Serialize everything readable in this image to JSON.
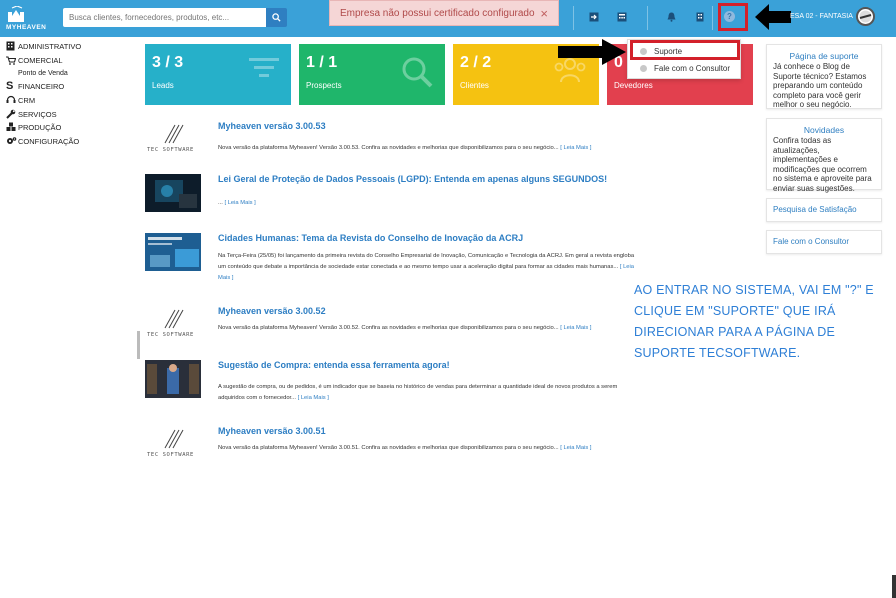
{
  "topbar": {
    "logo_text": "MYHEAVEN",
    "search_placeholder": "Busca clientes, fornecedores, produtos, etc...",
    "toast_message": "Empresa não possui certificado configurado",
    "toast_close": "×",
    "help_glyph": "?",
    "company_label": "ESA 02 - FANTASIA",
    "bg_color": "#3aa1d8"
  },
  "sidebar": {
    "items": [
      {
        "label": "ADMINISTRATIVO",
        "icon": "building-icon"
      },
      {
        "label": "COMERCIAL",
        "icon": "cart-icon"
      },
      {
        "label": "Ponto de Venda",
        "icon": "pos-icon"
      },
      {
        "label": "FINANCEIRO",
        "icon": "dollar-icon"
      },
      {
        "label": "CRM",
        "icon": "headset-icon"
      },
      {
        "label": "SERVIÇOS",
        "icon": "wrench-icon"
      },
      {
        "label": "PRODUÇÃO",
        "icon": "cubes-icon"
      },
      {
        "label": "CONFIGURAÇÃO",
        "icon": "gears-icon"
      }
    ]
  },
  "cards": [
    {
      "value": "3 / 3",
      "label": "Leads",
      "color": "#26b0c9",
      "icon": "funnel-icon"
    },
    {
      "value": "1 / 1",
      "label": "Prospects",
      "color": "#1fb66b",
      "icon": "magnifier-icon"
    },
    {
      "value": "2 / 2",
      "label": "Clientes",
      "color": "#f5c211",
      "icon": "users-icon"
    },
    {
      "value": "0",
      "label": "Devedores",
      "color": "#e2404e",
      "icon": "warning-icon"
    }
  ],
  "dropdown": {
    "items": [
      {
        "label": "Suporte"
      },
      {
        "label": "Fale com o Consultor"
      }
    ]
  },
  "right_panel": {
    "blog": {
      "title": "Página de suporte",
      "body": "Já conhece o Blog de Suporte técnico? Estamos preparando um conteúdo completo para você gerir melhor o seu negócio."
    },
    "news": {
      "title": "Novidades",
      "body": "Confira todas as atualizações, implementações e modificações que ocorrem no sistema e aproveite para enviar suas sugestões."
    },
    "survey_link": "Pesquisa de Satisfação",
    "consultant_link": "Fale com o Consultor"
  },
  "news": [
    {
      "title": "Myheaven versão 3.00.53",
      "desc": "Nova versão da plataforma Myheaven! Versão 3.00.53. Confira as novidades e melhorias que disponibilizamos para o seu negócio...",
      "more": "[ Leia Mais ]",
      "thumb": "tec-software-logo"
    },
    {
      "title": "Lei Geral de Proteção de Dados Pessoais (LGPD): Entenda em apenas alguns SEGUNDOS!",
      "desc": "...",
      "more": "[ Leia Mais ]",
      "thumb": "lgpd-photo"
    },
    {
      "title": "Cidades Humanas: Tema da Revista do Conselho de Inovação da ACRJ",
      "desc": "Na Terça-Feira (25/05) foi lançamento da primeira revista do Conselho Empresarial de Inovação, Comunicação e Tecnologia da ACRJ. Em geral a revista engloba um conteúdo que debate a importância de sociedade estar conectada e ao mesmo tempo usar a aceleração digital para formar as cidades mais humanas...",
      "more": "[ Leia Mais ]",
      "thumb": "magazine-photo"
    },
    {
      "title": "Myheaven versão 3.00.52",
      "desc": "Nova versão da plataforma Myheaven! Versão 3.00.52. Confira as novidades e melhorias que disponibilizamos para o seu negócio...",
      "more": "[ Leia Mais ]",
      "thumb": "tec-software-logo"
    },
    {
      "title": "Sugestão de Compra: entenda essa ferramenta agora!",
      "desc": "A sugestão de compra, ou de pedidos, é um indicador que se baseia no histórico de vendas para determinar a quantidade ideal de novos produtos a serem adquiridos com o fornecedor...",
      "more": "[ Leia Mais ]",
      "thumb": "warehouse-photo"
    },
    {
      "title": "Myheaven versão 3.00.51",
      "desc": "Nova versão da plataforma Myheaven! Versão 3.00.51. Confira as novidades e melhorias que disponibilizamos para o seu negócio...",
      "more": "[ Leia Mais ]",
      "thumb": "tec-software-logo"
    }
  ],
  "tec_logo_text": "TEC SOFTWARE",
  "annotation": "AO ENTRAR NO SISTEMA, VAI EM \"?\" E CLIQUE EM \"SUPORTE\" QUE IRÁ DIRECIONAR PARA A PÁGINA DE SUPORTE TECSOFTWARE."
}
